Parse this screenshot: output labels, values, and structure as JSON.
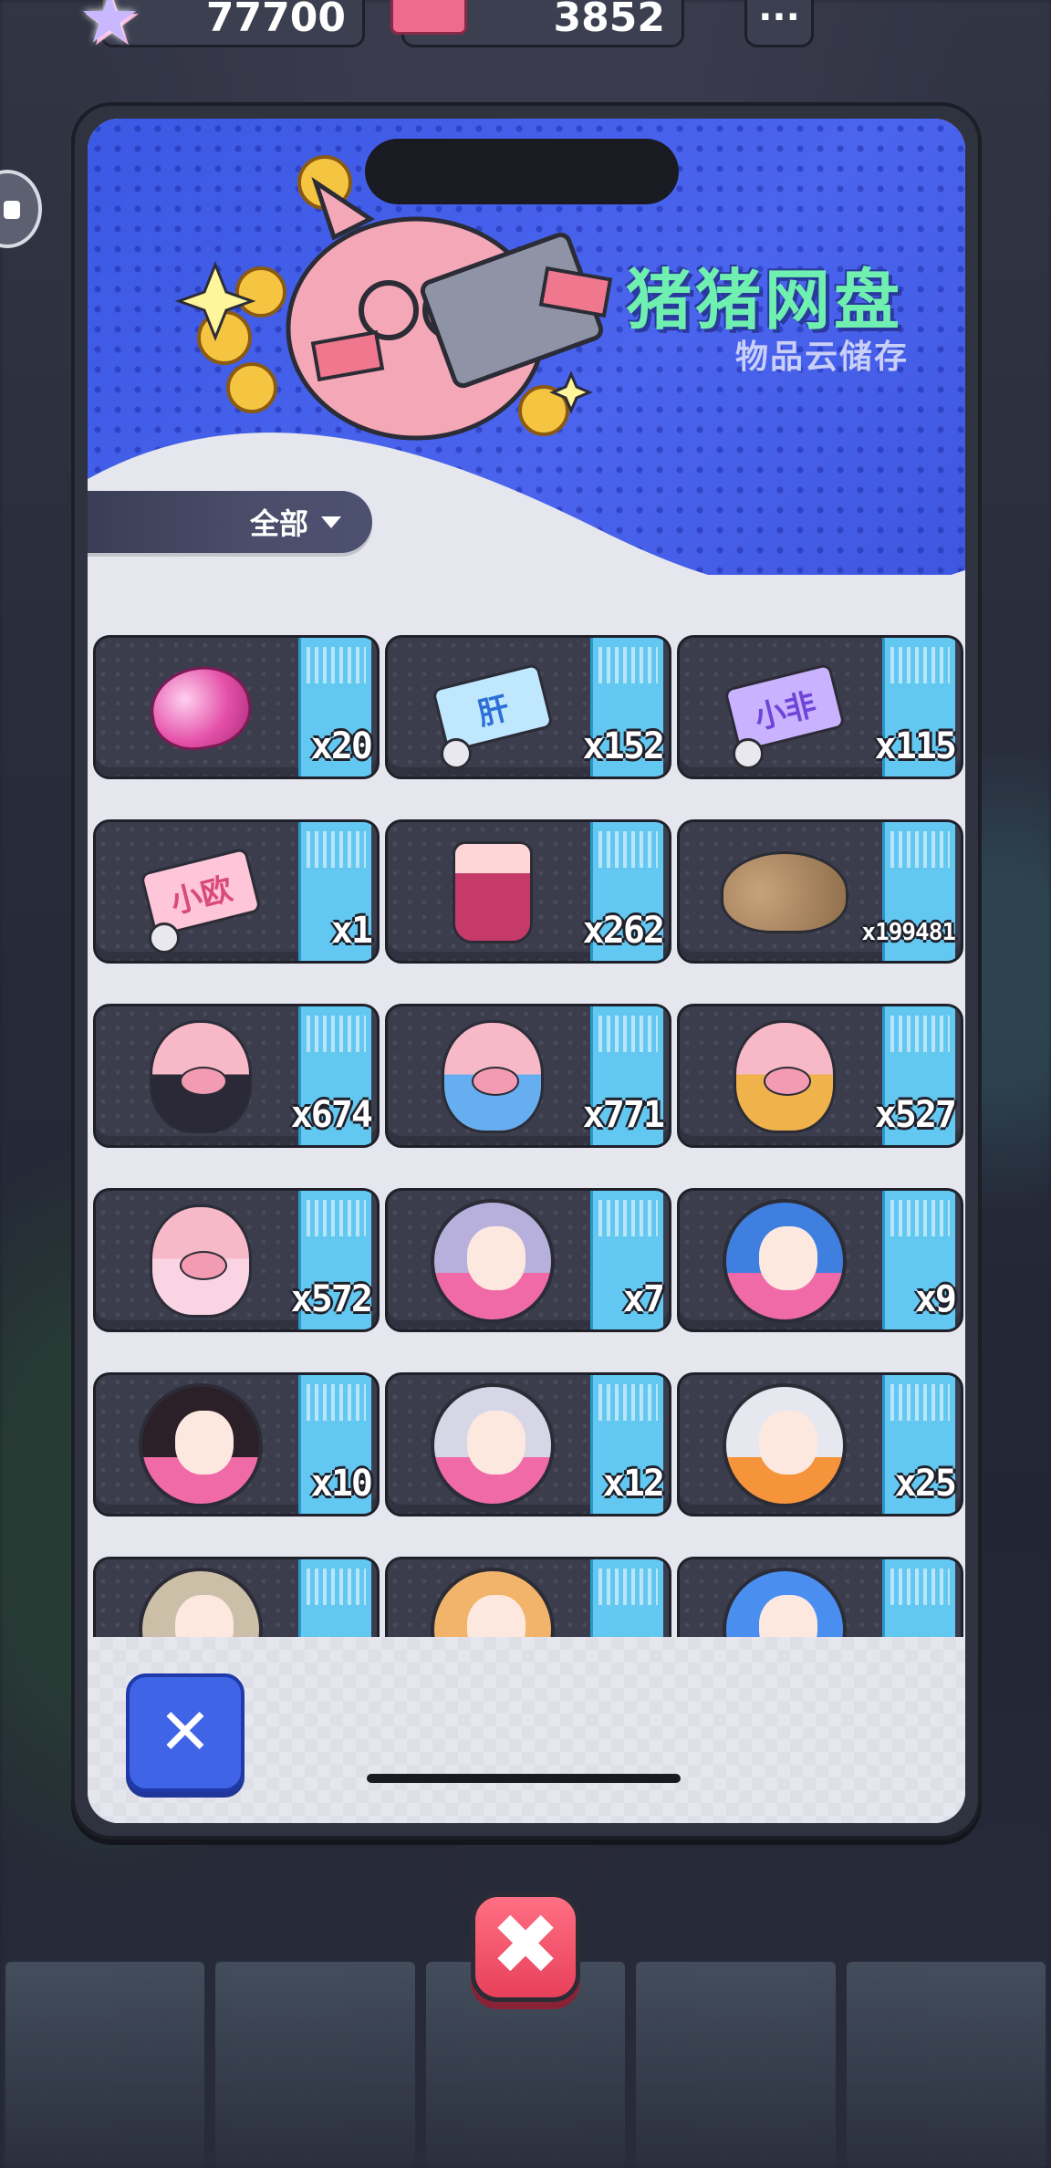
{
  "currency": {
    "stars": "77700",
    "tickets": "3852",
    "more_label": "..."
  },
  "panel": {
    "title": "猪猪网盘",
    "subtitle": "物品云储存",
    "filter_label": "全部"
  },
  "items": [
    {
      "icon": "pink-gem-icon",
      "qty": "x20"
    },
    {
      "icon": "liver-ticket-icon",
      "ticket_text": "肝",
      "qty": "x152"
    },
    {
      "icon": "unlucky-ticket-icon",
      "ticket_text": "小非",
      "qty": "x115"
    },
    {
      "icon": "lucky-ticket-icon",
      "ticket_text": "小欧",
      "qty": "x1"
    },
    {
      "icon": "milk-tea-cup-icon",
      "qty": "x262"
    },
    {
      "icon": "snail-shell-icon",
      "qty": "x199481"
    },
    {
      "icon": "black-outfit-pig-icon",
      "qty": "x674"
    },
    {
      "icon": "blue-outfit-pig-icon",
      "qty": "x771"
    },
    {
      "icon": "yellow-outfit-pig-icon",
      "qty": "x527"
    },
    {
      "icon": "pink-outfit-pig-icon",
      "qty": "x572"
    },
    {
      "icon": "lilac-hair-girl-avatar-icon",
      "qty": "x7"
    },
    {
      "icon": "blue-hair-girl-avatar-icon",
      "qty": "x9"
    },
    {
      "icon": "black-hair-fan-girl-avatar-icon",
      "qty": "x10"
    },
    {
      "icon": "silver-hair-girl-avatar-icon",
      "qty": "x12"
    },
    {
      "icon": "white-hair-winking-girl-avatar-icon",
      "qty": "x25"
    },
    {
      "icon": "beige-hair-girl-avatar-icon",
      "qty": ""
    },
    {
      "icon": "orange-hair-girl-avatar-icon",
      "qty": ""
    },
    {
      "icon": "blue-hair-girl-avatar-icon",
      "qty": ""
    }
  ],
  "buttons": {
    "close_small_glyph": "✕",
    "close_big_glyph": "✖"
  },
  "colors": {
    "header_blue": "#4b64ee",
    "title_green": "#6ff0b0",
    "qty_strip": "#63c8f1",
    "close_red": "#e8405b",
    "close_blue": "#3f64e6"
  }
}
